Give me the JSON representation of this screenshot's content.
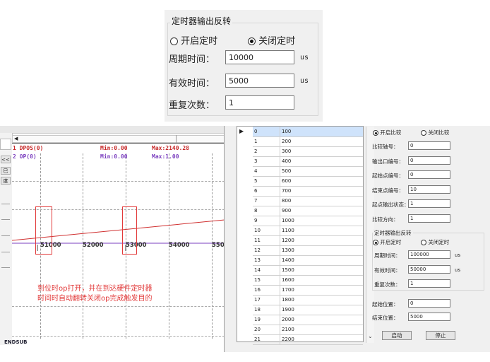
{
  "top_panel": {
    "title": "定时器输出反转",
    "radio_on_label": "开启定时",
    "radio_off_label": "关闭定时",
    "period_label": "周期时间：",
    "period_value": "10000",
    "period_unit": "us",
    "valid_label": "有效时间：",
    "valid_value": "5000",
    "valid_unit": "us",
    "repeat_label": "重复次数：",
    "repeat_value": "1"
  },
  "chart": {
    "signal1_label": "1 DPOS(0)",
    "signal1_min": "Min:0.00",
    "signal1_max": "Max:2140.28",
    "signal1_color": "#c62828",
    "signal2_label": "2 OP(0)",
    "signal2_min": "Min:0.00",
    "signal2_max": "Max:1.00",
    "signal2_color": "#7b3fbf",
    "x_ticks": [
      "51000",
      "52000",
      "53000",
      "54000",
      "550"
    ],
    "annotation_line1": "到位时op打开，并在到达硬件定时器",
    "annotation_line2": "时间时自动翻转关闭op完成触发目的",
    "annotation_color": "#e23a3a",
    "side_labels": [
      "<<",
      "巳",
      "度"
    ],
    "footer_text": "ENDSUB"
  },
  "table": {
    "rows": [
      [
        "0",
        "100"
      ],
      [
        "1",
        "200"
      ],
      [
        "2",
        "300"
      ],
      [
        "3",
        "400"
      ],
      [
        "4",
        "500"
      ],
      [
        "5",
        "600"
      ],
      [
        "6",
        "700"
      ],
      [
        "7",
        "800"
      ],
      [
        "8",
        "900"
      ],
      [
        "9",
        "1000"
      ],
      [
        "10",
        "1100"
      ],
      [
        "11",
        "1200"
      ],
      [
        "12",
        "1300"
      ],
      [
        "13",
        "1400"
      ],
      [
        "14",
        "1500"
      ],
      [
        "15",
        "1600"
      ],
      [
        "16",
        "1700"
      ],
      [
        "17",
        "1800"
      ],
      [
        "18",
        "1900"
      ],
      [
        "19",
        "2000"
      ],
      [
        "20",
        "2100"
      ],
      [
        "21",
        "2200"
      ]
    ]
  },
  "right_form": {
    "compare_on_label": "开启比较",
    "compare_off_label": "关闭比较",
    "axis_label": "比较轴号：",
    "axis_value": "0",
    "output_port_label": "输出口编号：",
    "output_port_value": "0",
    "start_point_label": "起始点编号：",
    "start_point_value": "0",
    "end_point_label": "结束点编号：",
    "end_point_value": "10",
    "start_state_label": "起点输出状态：",
    "start_state_value": "1",
    "direction_label": "比较方向：",
    "direction_value": "1",
    "timer_group_title": "定时器输出反转",
    "timer_on_label": "开启定时",
    "timer_off_label": "关闭定时",
    "period_label": "周期时间：",
    "period_value": "100000",
    "period_unit": "us",
    "valid_label": "有效时间：",
    "valid_value": "50000",
    "valid_unit": "us",
    "repeat_label": "重复次数：",
    "repeat_value": "1",
    "start_pos_label": "起始位置：",
    "start_pos_value": "0",
    "end_pos_label": "结束位置：",
    "end_pos_value": "5000",
    "start_button": "启动",
    "stop_button": "停止"
  }
}
